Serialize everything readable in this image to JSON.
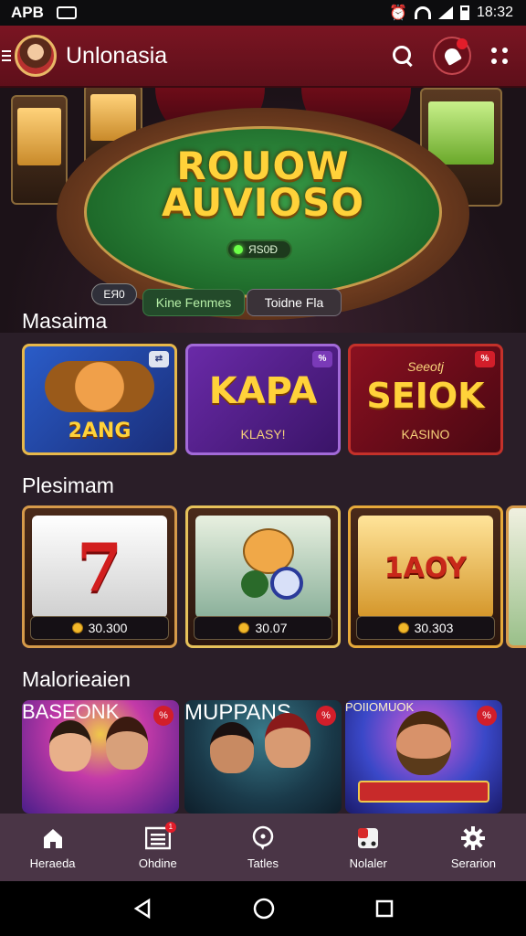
{
  "status_bar": {
    "left_text": "APB",
    "time": "18:32"
  },
  "app_bar": {
    "title": "Unlonasia"
  },
  "hero": {
    "title_line1": "ROUOW",
    "title_line2": "AUVIOSO",
    "pill_text": "ЯS0Ð",
    "chip_text": "EЯ0",
    "button_primary": "Kine Fenmes",
    "button_secondary": "Toidne Fla"
  },
  "sections": {
    "masaima": {
      "title": "Masaima",
      "cards": [
        {
          "title": "2ANG",
          "badge": "⇄"
        },
        {
          "title": "KAPA",
          "subtitle": "KLASY!",
          "badge": "%"
        },
        {
          "title": "SEIOK",
          "subtitle": "KASINO",
          "top_text": "Seeotj",
          "badge": "%"
        }
      ]
    },
    "plesimam": {
      "title": "Plesimam",
      "cards": [
        {
          "art_text": "7",
          "price": "30.300"
        },
        {
          "art_text": "",
          "price": "30.07"
        },
        {
          "art_text": "1AOY",
          "price": "30.303"
        }
      ]
    },
    "malorieaien": {
      "title": "Malorieaien",
      "cards": [
        {
          "title": "BASEONK",
          "badge": "%"
        },
        {
          "title": "MUPPANS",
          "badge": "%"
        },
        {
          "title": "POIIOMUOK",
          "badge": "%"
        }
      ]
    }
  },
  "bottom_nav": [
    {
      "label": "Heraeda",
      "icon": "home-icon",
      "badge": ""
    },
    {
      "label": "Ohdine",
      "icon": "list-icon",
      "badge": "1"
    },
    {
      "label": "Tatles",
      "icon": "chat-icon",
      "badge": ""
    },
    {
      "label": "Nolaler",
      "icon": "dice-icon",
      "badge": ""
    },
    {
      "label": "Serarion",
      "icon": "gear-icon",
      "badge": ""
    }
  ],
  "colors": {
    "app_bar": "#7a1522",
    "background": "#2a1e28",
    "bottom_nav": "#4a3546",
    "accent_gold": "#ffd23a",
    "badge_red": "#e21d2a"
  }
}
